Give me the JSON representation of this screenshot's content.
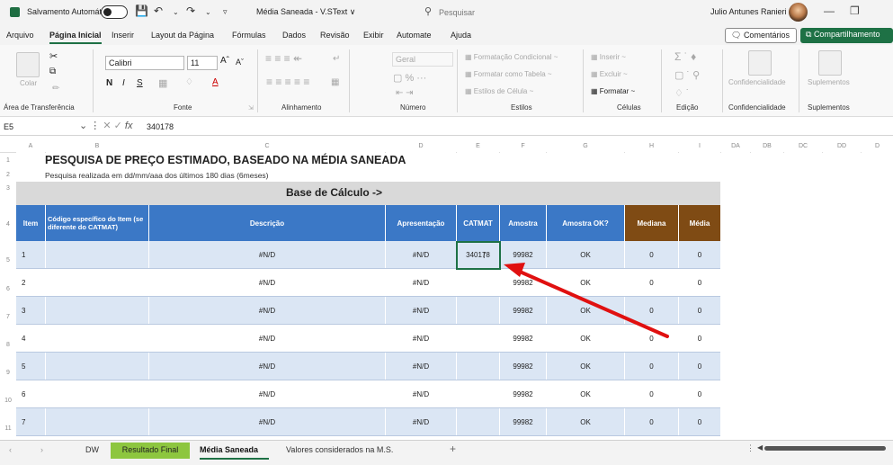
{
  "title_bar": {
    "autosave": "Salvamento Automático",
    "doc_title": "Média Saneada - V.SText ∨",
    "search_placeholder": "Pesquisar",
    "user": "Julio Antunes Ranieri"
  },
  "menu": {
    "items": [
      "Arquivo",
      "Página Inicial",
      "Inserir",
      "Layout da Página",
      "Fórmulas",
      "Dados",
      "Revisão",
      "Exibir",
      "Automate",
      "Ajuda"
    ],
    "comments": "Comentários",
    "share": "Compartilhamento"
  },
  "ribbon": {
    "paste": "Colar",
    "font_name": "Calibri",
    "font_size": "11",
    "number_format": "Geral",
    "styles": [
      "Formatação Condicional ~",
      "Formatar como Tabela ~",
      "Estilos de Célula ~"
    ],
    "cells": [
      "Inserir",
      "Excluir",
      "Formatar ~"
    ],
    "confidentiality": "Confidencialidade",
    "suplementos": "Suplementos",
    "groups": [
      "Área de Transferência",
      "Fonte",
      "Alinhamento",
      "Número",
      "Estilos",
      "Células",
      "Edição",
      "Confidencialidade",
      "Suplementos"
    ]
  },
  "formula_bar": {
    "name_box": "E5",
    "value": "340178"
  },
  "columns": [
    "A",
    "B",
    "C",
    "D",
    "E",
    "F",
    "G",
    "H",
    "I",
    "DA",
    "DB",
    "DC",
    "DD",
    "D"
  ],
  "row_numbers": [
    "1",
    "2",
    "3",
    "4",
    "5",
    "6",
    "7",
    "8",
    "9",
    "10",
    "11"
  ],
  "sheet": {
    "title": "PESQUISA DE PREÇO ESTIMADO, BASEADO NA MÉDIA SANEADA",
    "subtitle": "Pesquisa realizada em dd/mm/aaa dos últimos 180 dias (6meses)",
    "calc_label": "Base de Cálculo ->",
    "headers": {
      "item": "Item",
      "codigo": "Código específico do Item (se diferente do CATMAT)",
      "descricao": "Descrição",
      "apresentacao": "Apresentação",
      "catmat": "CATMAT",
      "amostra": "Amostra",
      "amostra_ok": "Amostra OK?",
      "mediana": "Mediana",
      "media": "Média"
    },
    "rows": [
      {
        "item": "1",
        "descricao": "#N/D",
        "apresentacao": "#N/D",
        "catmat": "340178",
        "amostra": "99982",
        "ok": "OK",
        "mediana": "0",
        "media": "0"
      },
      {
        "item": "2",
        "descricao": "#N/D",
        "apresentacao": "#N/D",
        "catmat": "",
        "amostra": "99982",
        "ok": "OK",
        "mediana": "0",
        "media": "0"
      },
      {
        "item": "3",
        "descricao": "#N/D",
        "apresentacao": "#N/D",
        "catmat": "",
        "amostra": "99982",
        "ok": "OK",
        "mediana": "0",
        "media": "0"
      },
      {
        "item": "4",
        "descricao": "#N/D",
        "apresentacao": "#N/D",
        "catmat": "",
        "amostra": "99982",
        "ok": "OK",
        "mediana": "0",
        "media": "0"
      },
      {
        "item": "5",
        "descricao": "#N/D",
        "apresentacao": "#N/D",
        "catmat": "",
        "amostra": "99982",
        "ok": "OK",
        "mediana": "0",
        "media": "0"
      },
      {
        "item": "6",
        "descricao": "#N/D",
        "apresentacao": "#N/D",
        "catmat": "",
        "amostra": "99982",
        "ok": "OK",
        "mediana": "0",
        "media": "0"
      },
      {
        "item": "7",
        "descricao": "#N/D",
        "apresentacao": "#N/D",
        "catmat": "",
        "amostra": "99982",
        "ok": "OK",
        "mediana": "0",
        "media": "0"
      }
    ]
  },
  "tabs": [
    "DW",
    "Resultado Final",
    "Média Saneada",
    "Valores considerados na M.S."
  ],
  "colors": {
    "excel_green": "#1e7145",
    "header_blue": "#3b78c6",
    "header_brown": "#7f4b14",
    "tab_green": "#8dc63f",
    "arrow": "#e01010"
  }
}
